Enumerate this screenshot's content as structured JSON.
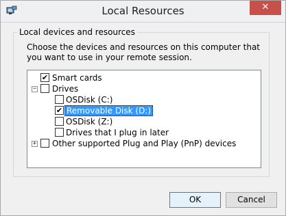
{
  "window": {
    "title": "Local Resources",
    "close_glyph": "✕",
    "accent": "#c7514a"
  },
  "group": {
    "label": "Local devices and resources",
    "instructions": "Choose the devices and resources on this computer that you want to use in your remote session."
  },
  "tree": {
    "smart_cards": {
      "label": "Smart cards",
      "checked": true
    },
    "drives": {
      "label": "Drives",
      "expanded": true,
      "checked": false,
      "children": [
        {
          "label": "OSDisk (C:)",
          "checked": false
        },
        {
          "label": "Removable Disk (D:)",
          "checked": true,
          "selected": true
        },
        {
          "label": "OSDisk (Z:)",
          "checked": false
        },
        {
          "label": "Drives that I plug in later",
          "checked": false
        }
      ]
    },
    "pnp": {
      "label": "Other supported Plug and Play (PnP) devices",
      "checked": false,
      "expanded": false
    }
  },
  "buttons": {
    "ok": "OK",
    "cancel": "Cancel"
  },
  "glyphs": {
    "check": "✔",
    "expanded": "−",
    "collapsed": "+"
  }
}
